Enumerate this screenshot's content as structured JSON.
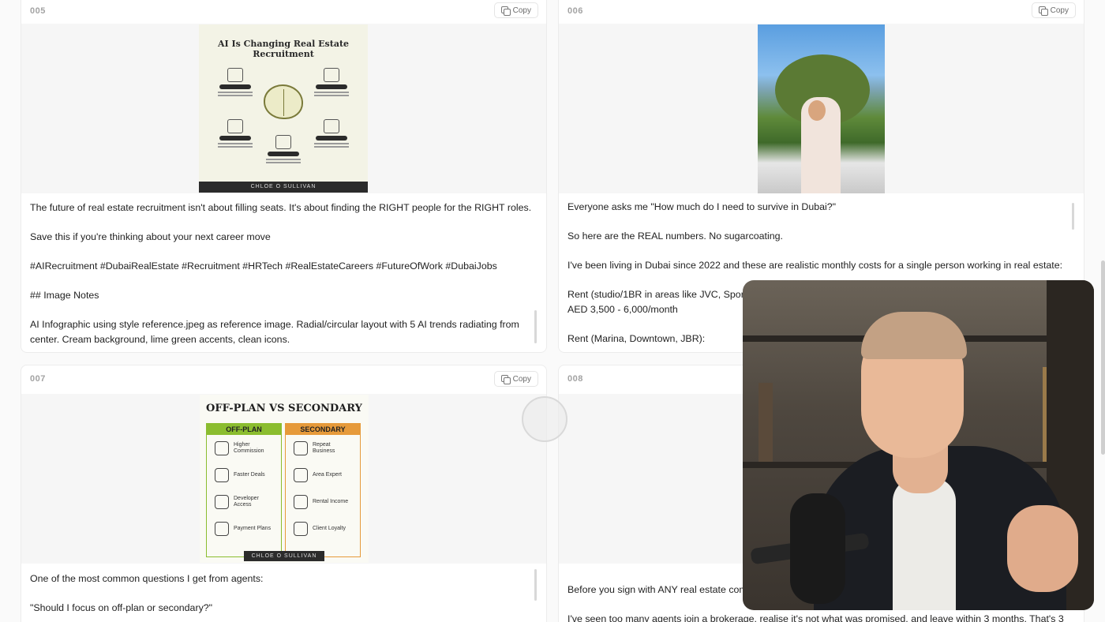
{
  "copy_label": "Copy",
  "cards": [
    {
      "number": "005",
      "image": {
        "title_line1": "AI Is Changing Real Estate",
        "title_line2": "Recruitment",
        "footer": "CHLOE O SULLIVAN"
      },
      "paragraphs": [
        "The future of real estate recruitment isn't about filling seats. It's about finding the RIGHT people for the RIGHT roles.",
        "Save this if you're thinking about your next career move",
        "#AIRecruitment #DubaiRealEstate #Recruitment #HRTech #RealEstateCareers #FutureOfWork #DubaiJobs",
        "## Image Notes",
        "AI Infographic using style reference.jpeg as reference image. Radial/circular layout with 5 AI trends radiating from center. Cream background, lime green accents, clean icons."
      ]
    },
    {
      "number": "006",
      "paragraphs": [
        "Everyone asks me \"How much do I need to survive in Dubai?\"",
        "So here are the REAL numbers. No sugarcoating.",
        "I've been living in Dubai since 2022 and these are realistic monthly costs for a single person working in real estate:",
        "Rent (studio/1BR in areas like JVC, Sports",
        "AED 3,500 - 6,000/month",
        "Rent (Marina, Downtown, JBR):"
      ]
    },
    {
      "number": "007",
      "image": {
        "title": "OFF-PLAN VS SECONDARY",
        "left_header": "OFF-PLAN",
        "right_header": "SECONDARY",
        "left_items": [
          "Higher Commission",
          "Faster Deals",
          "Developer Access",
          "Payment Plans"
        ],
        "right_items": [
          "Repeat Business",
          "Area Expert",
          "Rental Income",
          "Client Loyalty"
        ],
        "footer": "CHLOE O SULLIVAN"
      },
      "paragraphs": [
        "One of the most common questions I get from agents:",
        "\"Should I focus on off-plan or secondary?\""
      ]
    },
    {
      "number": "008",
      "paragraphs": [
        "Before you sign with ANY real estate comp",
        "I've seen too many agents join a brokerage, realise it's not what was promised, and leave within 3 months. That's 3"
      ]
    }
  ],
  "colors": {
    "offplan_accent": "#8bbd2f",
    "secondary_accent": "#e69a3a",
    "page_background": "#fafafa"
  }
}
